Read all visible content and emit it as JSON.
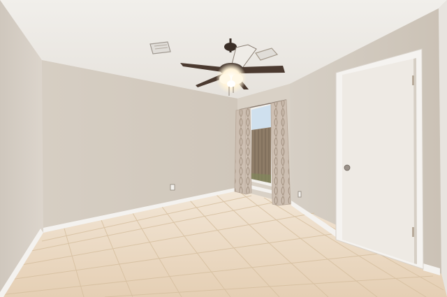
{
  "scene": {
    "description_free": true,
    "colors": {
      "ceiling": "#ece9e5",
      "wall_left": "#d8d1c8",
      "wall_back": "#d4ccc1",
      "wall_right": "#d1c9bd",
      "floor_tile": "#ead8c2",
      "grout": "#d9c3a8",
      "baseboard": "#f3f1ee",
      "door": "#efebe6",
      "door_frame": "#f4f2ef",
      "curtain": "#cbbdb0",
      "curtain_pattern": "#a89888",
      "window_sky": "#c9dcec",
      "fence": "#8b7a66",
      "fan_blade": "#4a3a30",
      "fan_light": "#fff6dc"
    },
    "objects": [
      "ceiling-fan",
      "air-vent",
      "window",
      "curtain-left",
      "curtain-right",
      "closet-door",
      "electrical-outlet",
      "tile-floor",
      "baseboard"
    ]
  }
}
